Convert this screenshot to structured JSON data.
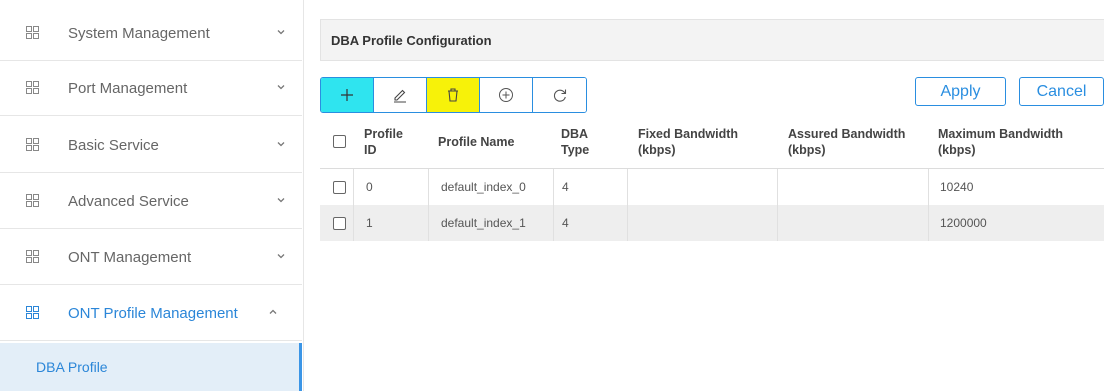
{
  "sidebar": {
    "items": [
      {
        "label": "System Management",
        "icon": "grid-icon",
        "chevron": "down"
      },
      {
        "label": "Port Management",
        "icon": "grid-icon",
        "chevron": "down"
      },
      {
        "label": "Basic Service",
        "icon": "grid-icon",
        "chevron": "down"
      },
      {
        "label": "Advanced Service",
        "icon": "grid-icon",
        "chevron": "down"
      },
      {
        "label": "ONT Management",
        "icon": "grid-icon",
        "chevron": "down"
      },
      {
        "label": "ONT Profile Management",
        "icon": "grid-icon",
        "chevron": "up"
      }
    ],
    "sub_items": [
      {
        "label": "DBA Profile"
      }
    ]
  },
  "panel": {
    "title": "DBA Profile Configuration"
  },
  "toolbar": {
    "buttons": [
      {
        "name": "add",
        "icon": "plus-icon",
        "color": "#2fe4ef"
      },
      {
        "name": "edit",
        "icon": "pencil-icon"
      },
      {
        "name": "delete",
        "icon": "trash-icon",
        "color": "#f7f209"
      },
      {
        "name": "search",
        "icon": "circle-plus-icon"
      },
      {
        "name": "refresh",
        "icon": "refresh-icon"
      }
    ],
    "apply_label": "Apply",
    "cancel_label": "Cancel"
  },
  "table": {
    "columns": [
      "Profile ID",
      "Profile Name",
      "DBA Type",
      "Fixed Bandwidth (kbps)",
      "Assured Bandwidth (kbps)",
      "Maximum Bandwidth (kbps)"
    ],
    "rows": [
      [
        "0",
        "default_index_0",
        "4",
        "",
        "",
        "10240"
      ],
      [
        "1",
        "default_index_1",
        "4",
        "",
        "",
        "1200000"
      ]
    ]
  },
  "colors": {
    "accent": "#2a8ee0",
    "active_text": "#2b86d8",
    "submenu_bg": "#e3eef8"
  }
}
